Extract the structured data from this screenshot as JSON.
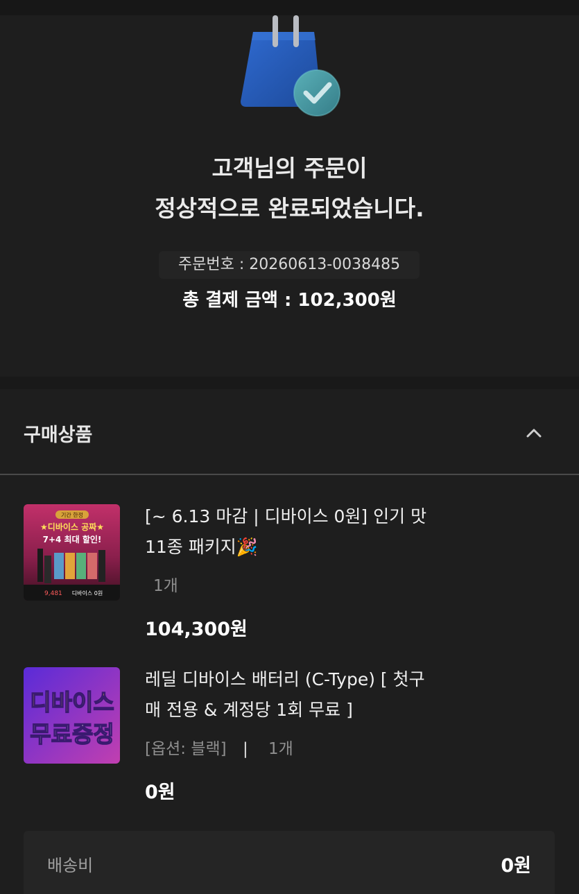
{
  "complete": {
    "headline_line1": "고객님의 주문이",
    "headline_line2": "정상적으로 완료되었습니다.",
    "order_number": "주문번호 : 20260613-0038485",
    "total_amount": "총 결제 금액 : 102,300원"
  },
  "products": {
    "section_title": "구매상품",
    "items": [
      {
        "name_line1": "[~ 6.13 마감 | 디바이스 0원] 인기 맛",
        "name_line2": "11종 패키지🎉",
        "option": "",
        "quantity": "1개",
        "price": "104,300원",
        "thumb_text": {
          "badge": "기간 한정",
          "title": "★디바이스 공짜★",
          "sub": "7+4 최대 할인!",
          "price": "9,481",
          "tag": "디바이스 0원"
        }
      },
      {
        "name_line1": "레딜 디바이스 배터리 (C-Type) [ 첫구",
        "name_line2": "매 전용 & 계정당 1회 무료 ]",
        "option": "[옵션: 블랙]",
        "separator": "|",
        "quantity": "1개",
        "price": "0원",
        "thumb_text": {
          "line1": "디바이스",
          "line2": "무료증정"
        }
      }
    ]
  },
  "shipping": {
    "label": "배송비",
    "value": "0원"
  },
  "colors": {
    "background": "#1e1e1e",
    "bag_blue": "#2a5db8",
    "check_teal": "#4a9aa5"
  },
  "icons": {
    "bag": "shopping-bag-check-icon",
    "collapse": "chevron-up-icon"
  }
}
